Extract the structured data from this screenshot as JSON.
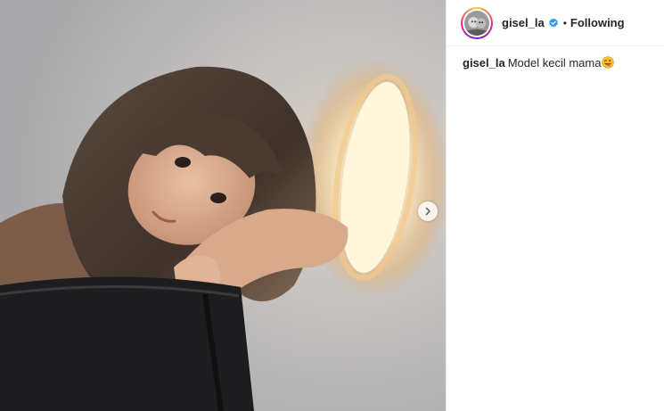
{
  "post": {
    "author": {
      "username": "gisel_la",
      "verified": true,
      "verified_icon": "verified-badge-icon",
      "follow_state": "Following",
      "separator": "•"
    },
    "caption": {
      "username": "gisel_la",
      "text": "Model kecil mama",
      "emoji": "😜",
      "emoji_icon": "winking-face-with-tongue-icon"
    },
    "media": {
      "description_icon": "photo",
      "next_icon": "chevron-right-icon"
    }
  },
  "colors": {
    "accent_verified": "#3897f0",
    "text": "#262626",
    "divider": "#efefef"
  }
}
